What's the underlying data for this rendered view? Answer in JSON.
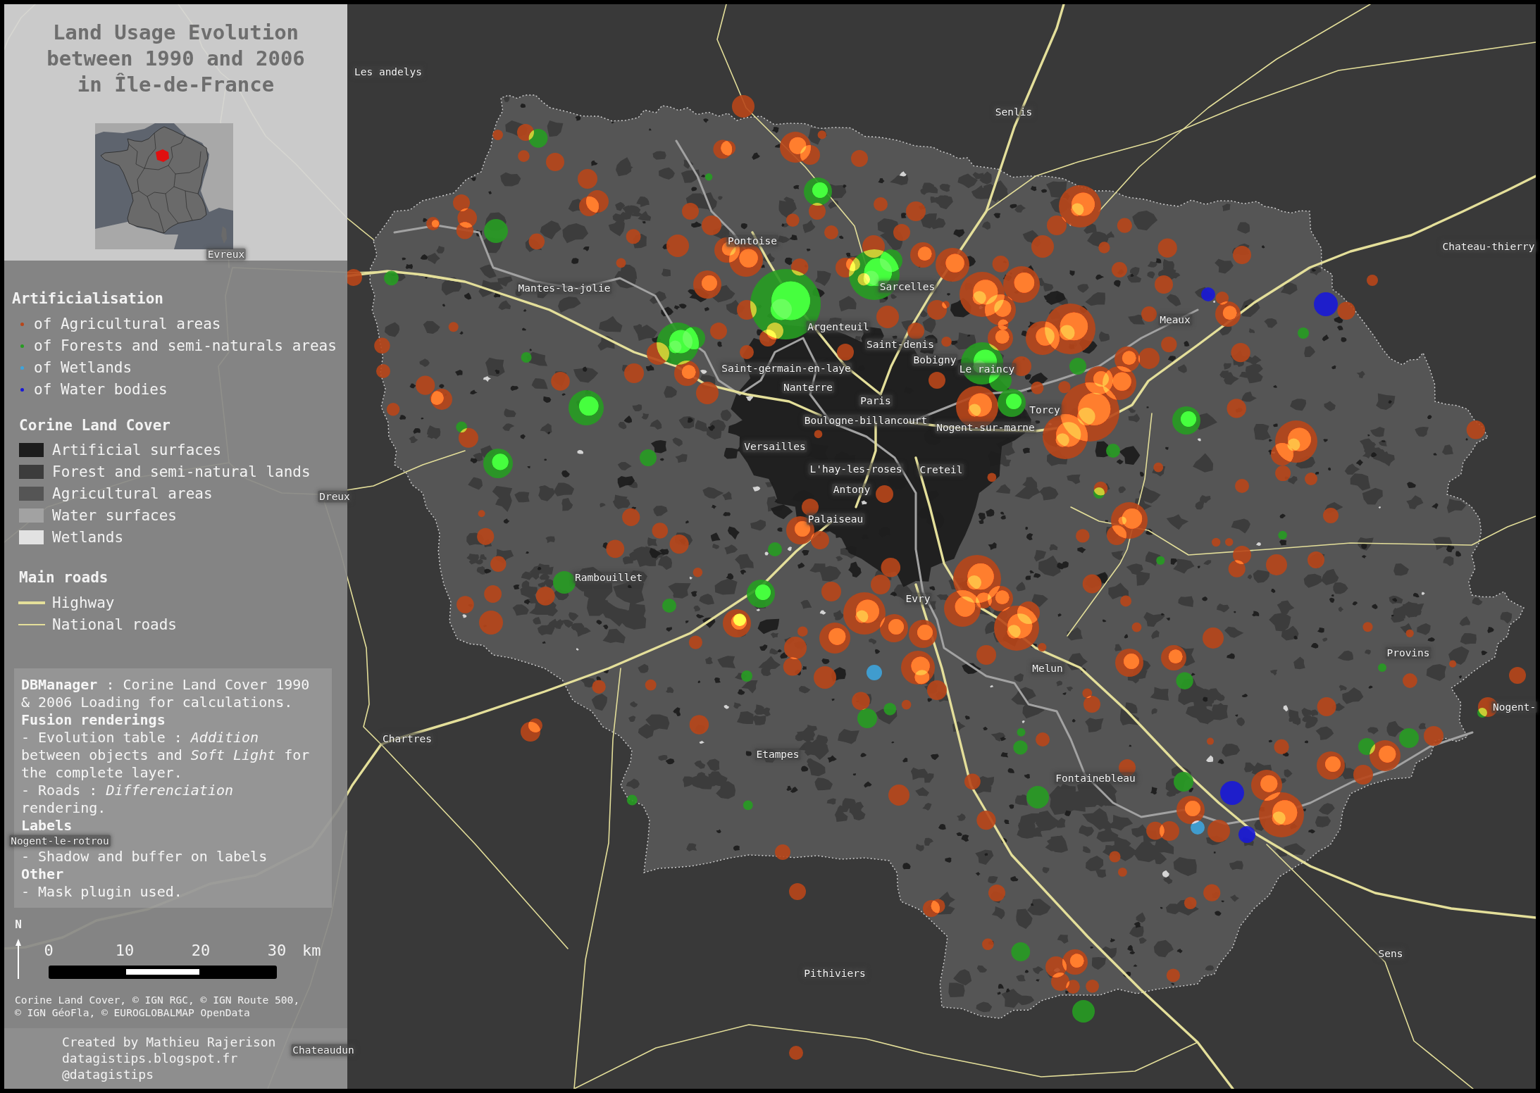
{
  "title_lines": [
    "Land Usage Evolution",
    "between 1990 and 2006",
    "in Île-de-France"
  ],
  "legend": {
    "artificialisation": {
      "heading": "Artificialisation",
      "items": [
        {
          "label": "of Agricultural areas",
          "color": "#b8461a"
        },
        {
          "label": "of Forests and semi-naturals areas",
          "color": "#279c22"
        },
        {
          "label": "of Wetlands",
          "color": "#3ea4dc"
        },
        {
          "label": "of Water bodies",
          "color": "#1818d8"
        }
      ]
    },
    "land_cover": {
      "heading": "Corine Land Cover",
      "items": [
        {
          "label": "Artificial surfaces",
          "color": "#1c1c1c"
        },
        {
          "label": "Forest and semi-natural lands",
          "color": "#3c3c3c"
        },
        {
          "label": "Agricultural areas",
          "color": "#555555"
        },
        {
          "label": "Water surfaces",
          "color": "#a2a2a2"
        },
        {
          "label": "Wetlands",
          "color": "#e2e2e2"
        }
      ]
    },
    "main_roads": {
      "heading": "Main roads",
      "items": [
        {
          "label": "Highway",
          "kind": "highway"
        },
        {
          "label": "National roads",
          "kind": "national"
        }
      ]
    }
  },
  "notes": [
    {
      "kind": "text",
      "text": "**DBManager** : Corine Land Cover 1990 & 2006 Loading for calculations."
    },
    {
      "kind": "heading",
      "text": "Fusion renderings"
    },
    {
      "kind": "text",
      "text": "- Evolution table : *Addition* between objects and *Soft Light* for the complete layer."
    },
    {
      "kind": "text",
      "text": "- Roads : *Differenciation* rendering."
    },
    {
      "kind": "heading",
      "text": "Labels"
    },
    {
      "kind": "text",
      "text": "- Shadow and buffer on labels"
    },
    {
      "kind": "heading",
      "text": "Other"
    },
    {
      "kind": "text",
      "text": "- Mask plugin used."
    }
  ],
  "scale_bar": {
    "north": "N",
    "ticks": [
      "0",
      "10",
      "20",
      "30"
    ],
    "unit": "km"
  },
  "sources": "Corine Land Cover, © IGN RGC, © IGN Route 500, © IGN GéoFla, © EUROGLOBALMAP OpenData",
  "credits": [
    "Created by Mathieu Rajerison",
    "datagistips.blogspot.fr",
    "@datagistips"
  ],
  "map": {
    "places": [
      "Les andelys",
      "Senlis",
      "Evreux",
      "Chateau-thierry",
      "Pontoise",
      "Mantes-la-jolie",
      "Sarcelles",
      "Meaux",
      "Argenteuil",
      "Saint-denis",
      "Saint-germain-en-laye",
      "Bobigny",
      "Le raincy",
      "Nanterre",
      "Paris",
      "Torcy",
      "Boulogne-billancourt",
      "Nogent-sur-marne",
      "Versailles",
      "L'hay-les-roses",
      "Creteil",
      "Dreux",
      "Antony",
      "Palaiseau",
      "Rambouillet",
      "Evry",
      "Provins",
      "Melun",
      "Nogent-",
      "Chartres",
      "Etampes",
      "Fontainebleau",
      "Nogent-le-rotrou",
      "Sens",
      "Pithiviers",
      "Chateaudun"
    ]
  }
}
